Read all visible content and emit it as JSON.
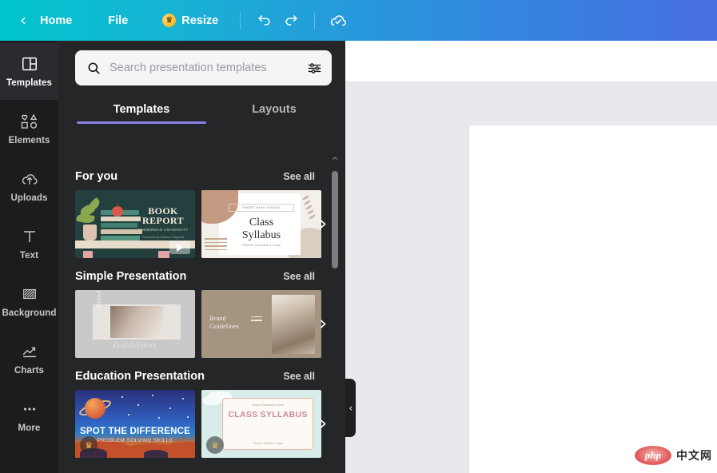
{
  "topbar": {
    "back_icon": "chevron-left-icon",
    "home_label": "Home",
    "file_label": "File",
    "resize_label": "Resize",
    "resize_badge_icon": "crown-icon",
    "undo_icon": "undo-icon",
    "redo_icon": "redo-icon",
    "cloud_save_icon": "cloud-check-icon"
  },
  "sidebar": {
    "items": [
      {
        "label": "Templates",
        "icon": "templates-icon",
        "active": true
      },
      {
        "label": "Elements",
        "icon": "elements-icon",
        "active": false
      },
      {
        "label": "Uploads",
        "icon": "uploads-icon",
        "active": false
      },
      {
        "label": "Text",
        "icon": "text-icon",
        "active": false
      },
      {
        "label": "Background",
        "icon": "background-icon",
        "active": false
      },
      {
        "label": "Charts",
        "icon": "charts-icon",
        "active": false
      },
      {
        "label": "More",
        "icon": "more-icon",
        "active": false
      }
    ]
  },
  "panel": {
    "search": {
      "value": "",
      "placeholder": "Search presentation templates",
      "search_icon": "search-icon",
      "filter_icon": "filter-sliders-icon"
    },
    "tabs": [
      {
        "label": "Templates",
        "active": true
      },
      {
        "label": "Layouts",
        "active": false
      }
    ],
    "see_all_label": "See all",
    "next_arrow_icon": "chevron-right-icon",
    "scroll_up_icon": "chevron-up-icon",
    "sections": [
      {
        "title": "For you",
        "see_all": "See all",
        "thumbnails": [
          {
            "name": "book-report",
            "title": "BOOK REPORT",
            "subtitle": "TIMMERMAN UNIVERSITY",
            "byline": "Presented by: Eleanor Fitzgerald",
            "premium": false,
            "has_play": true
          },
          {
            "name": "class-syllabus-minimal",
            "title": "Class Syllabus",
            "subtitle": "TANSET HIGH SCHOOL",
            "byline": "Teacher Charlotte's Class",
            "premium": false,
            "has_play": false
          }
        ]
      },
      {
        "title": "Simple Presentation",
        "see_all": "See all",
        "thumbnails": [
          {
            "name": "brand-guidelines-gray",
            "title": "Brand",
            "subtitle": "Guidelines",
            "byline": "",
            "premium": false,
            "has_play": false
          },
          {
            "name": "brand-guidelines-tan",
            "title": "Brand",
            "subtitle": "Guidelines",
            "byline": "",
            "premium": false,
            "has_play": false
          }
        ]
      },
      {
        "title": "Education Presentation",
        "see_all": "See all",
        "thumbnails": [
          {
            "name": "spot-the-difference",
            "title": "SPOT THE DIFFERENCE",
            "subtitle": "PROBLEM SOLVING SKILLS",
            "byline": "",
            "premium": true,
            "has_play": false
          },
          {
            "name": "class-syllabus-pastel",
            "title": "CLASS SYLLABUS",
            "subtitle": "Google Elementary School",
            "byline": "Teacher Eleanor's Class",
            "premium": true,
            "has_play": false
          }
        ]
      }
    ],
    "collapse_icon": "chevron-left-icon"
  },
  "canvas": {
    "watermark_brand": "php",
    "watermark_text": "中文网"
  },
  "colors": {
    "accent_purple": "#8b7fe8",
    "topbar_teal": "#00c4cc",
    "topbar_blue": "#4a6fe0",
    "panel_bg": "#252627",
    "sidebar_bg": "#1c1c1f",
    "canvas_bg": "#e8e9ed"
  }
}
